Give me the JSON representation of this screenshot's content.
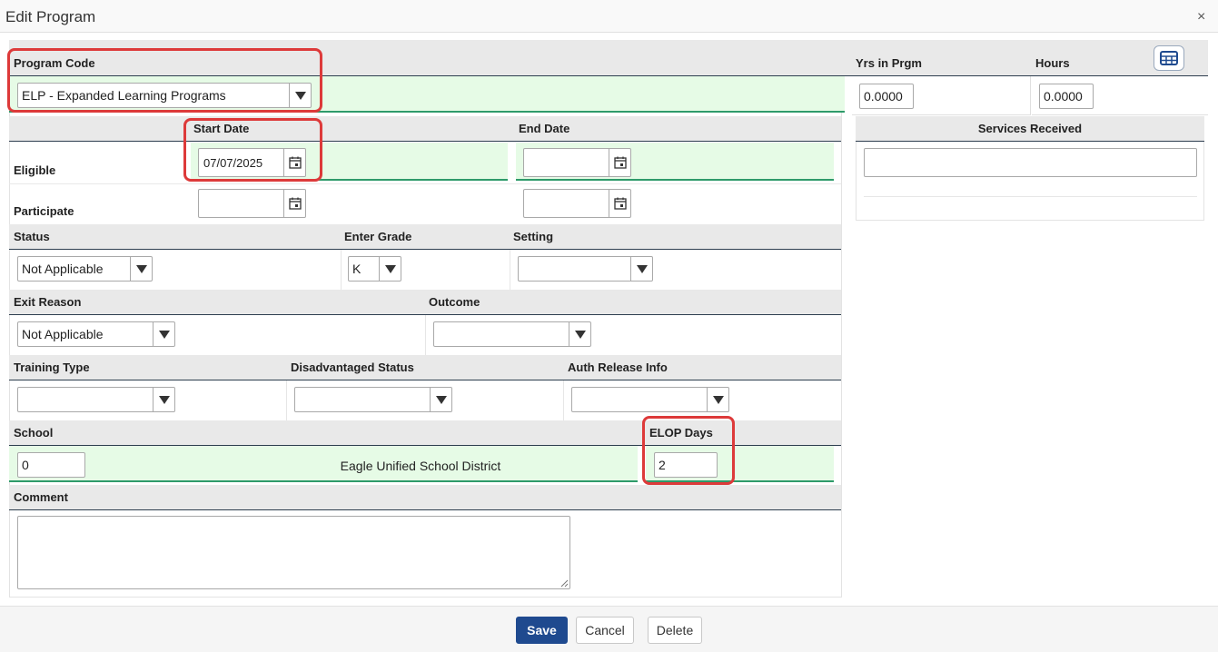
{
  "dialog": {
    "title": "Edit Program",
    "close_glyph": "×"
  },
  "program_code": {
    "label": "Program Code",
    "value": "ELP - Expanded Learning Programs"
  },
  "yrs_in_prgm": {
    "label": "Yrs in Prgm",
    "value": "0.0000"
  },
  "hours": {
    "label": "Hours",
    "value": "0.0000"
  },
  "dates": {
    "start_label": "Start Date",
    "end_label": "End Date",
    "eligible_label": "Eligible",
    "participate_label": "Participate",
    "eligible_start": "07/07/2025",
    "eligible_end": "",
    "participate_start": "",
    "participate_end": ""
  },
  "services_received": {
    "label": "Services Received",
    "value": ""
  },
  "status": {
    "label": "Status",
    "value": "Not Applicable"
  },
  "enter_grade": {
    "label": "Enter Grade",
    "value": "K"
  },
  "setting": {
    "label": "Setting",
    "value": ""
  },
  "exit_reason": {
    "label": "Exit Reason",
    "value": "Not Applicable"
  },
  "outcome": {
    "label": "Outcome",
    "value": ""
  },
  "training_type": {
    "label": "Training Type",
    "value": ""
  },
  "disadvantaged_status": {
    "label": "Disadvantaged Status",
    "value": ""
  },
  "auth_release_info": {
    "label": "Auth Release Info",
    "value": ""
  },
  "school": {
    "label": "School",
    "value": "0",
    "name": "Eagle Unified School District"
  },
  "elop_days": {
    "label": "ELOP Days",
    "value": "2"
  },
  "comment": {
    "label": "Comment",
    "value": ""
  },
  "footer": {
    "save": "Save",
    "cancel": "Cancel",
    "delete": "Delete"
  },
  "colors": {
    "primary": "#1f4a8f",
    "highlight": "#dd3a3a",
    "green_row": "#e6fbe6",
    "header_row": "#e9e9e9"
  }
}
